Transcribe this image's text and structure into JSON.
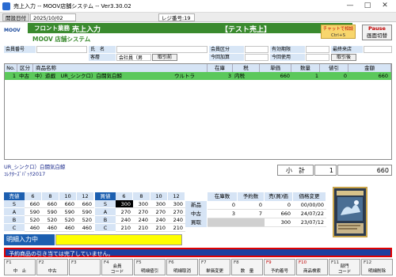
{
  "window": {
    "title": "売上入力 -- MOOV店舗システム -- Ver3.30.02"
  },
  "info_strip": {
    "date_label": "開設日付",
    "date_value": "2025/10/02",
    "register_label": "レジ番号:19"
  },
  "header": {
    "logo_text": "MOOV",
    "dept": "フロント業務",
    "screen": "売上入力",
    "mode": "【テスト売上】",
    "system_name": "MOOV 店舗システム",
    "chat_button_line1": "チャットで相談",
    "chat_button_line2": "Ctrl+S",
    "pause_line1": "Pause",
    "pause_line2": "画面切替"
  },
  "form": {
    "member_no_label": "会員番号",
    "name_label": "氏　名",
    "member_class_label": "会員区分",
    "expiry_label": "有効期限",
    "last_visit_label": "最終来店",
    "customer_label": "客層",
    "customer_value": "会社員（男",
    "customer_button": "取引前",
    "points_add_label": "今回加算",
    "points_use_label": "今回使用",
    "points_use_button": "取引後"
  },
  "grid": {
    "columns": [
      "No.",
      "区分",
      "商品名称",
      "在庫",
      "税",
      "単価",
      "数量",
      "値引",
      "金額"
    ],
    "rows": [
      {
        "no": "1",
        "kubun": "中古",
        "name": "中）遊戯　UR_シンクロ）白闘気白鯨",
        "rarity": "ウルトラ",
        "stock": "3",
        "tax": "内税",
        "price": "660",
        "qty": "1",
        "discount": "0",
        "amount": "660"
      }
    ]
  },
  "description": {
    "line1": "UR_シンクロ）白闘気白鯨",
    "line2": "ｺﾚｸﾀｰｽﾞﾊﾟｯｸ2017"
  },
  "subtotal": {
    "label": "小　計",
    "qty": "1",
    "amount": "660"
  },
  "sell_table": {
    "title": "売値",
    "columns": [
      "6",
      "8",
      "10",
      "12"
    ],
    "rows": [
      {
        "grade": "S",
        "values": [
          "660",
          "660",
          "660",
          "660"
        ]
      },
      {
        "grade": "A",
        "values": [
          "590",
          "590",
          "590",
          "590"
        ]
      },
      {
        "grade": "B",
        "values": [
          "520",
          "520",
          "520",
          "520"
        ]
      },
      {
        "grade": "C",
        "values": [
          "460",
          "460",
          "460",
          "460"
        ]
      }
    ]
  },
  "buy_table": {
    "title": "買値",
    "columns": [
      "6",
      "8",
      "10",
      "12"
    ],
    "rows": [
      {
        "grade": "S",
        "values": [
          "300",
          "300",
          "300",
          "300"
        ]
      },
      {
        "grade": "A",
        "values": [
          "270",
          "270",
          "270",
          "270"
        ]
      },
      {
        "grade": "B",
        "values": [
          "240",
          "240",
          "240",
          "240"
        ]
      },
      {
        "grade": "C",
        "values": [
          "210",
          "210",
          "210",
          "210"
        ]
      }
    ]
  },
  "stock_table": {
    "columns": [
      "在庫数",
      "予約数",
      "売(買)価",
      "価格変更"
    ],
    "rows": [
      {
        "label": "新品",
        "values": [
          "0",
          "0",
          "0",
          "00/00/00"
        ]
      },
      {
        "label": "中古",
        "values": [
          "3",
          "7",
          "660",
          "24/07/22"
        ]
      },
      {
        "label": "買取",
        "values": [
          "",
          "",
          "300",
          "23/07/12"
        ]
      }
    ]
  },
  "entry": {
    "label": "明細入力中",
    "value": ""
  },
  "status": {
    "message": "予約商品の引き当ては完了していません。"
  },
  "fkeys": [
    {
      "key": "F1",
      "label": "中　止",
      "red": false
    },
    {
      "key": "F2",
      "label": "中古",
      "red": false
    },
    {
      "key": "F3",
      "label": "",
      "red": false
    },
    {
      "key": "F4",
      "label": "会員\nコード",
      "red": false
    },
    {
      "key": "F5",
      "label": "明細値引",
      "red": false
    },
    {
      "key": "F6",
      "label": "明細取消",
      "red": false
    },
    {
      "key": "F7",
      "label": "単価変更",
      "red": false
    },
    {
      "key": "F8",
      "label": "数　量",
      "red": false
    },
    {
      "key": "F9",
      "label": "予約着号",
      "red": true
    },
    {
      "key": "F10",
      "label": "商品検索",
      "red": true
    },
    {
      "key": "F11",
      "label": "部門\nコード",
      "red": false
    },
    {
      "key": "F12",
      "label": "明細削除",
      "red": false
    }
  ]
}
